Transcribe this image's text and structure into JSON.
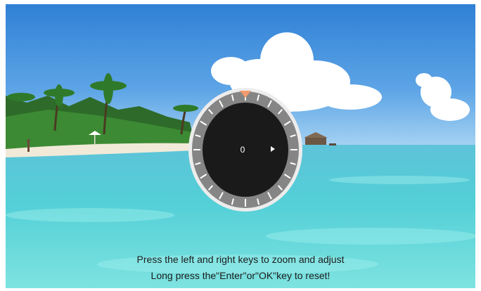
{
  "zoom_dial": {
    "value": "0",
    "arrow_icon": "right-arrow-icon",
    "pointer_icon": "triangle-pointer-icon"
  },
  "instructions": {
    "line1": "Press the left and right keys to zoom and adjust",
    "line2": "Long press the\"Enter\"or\"OK\"key to reset!"
  },
  "colors": {
    "pointer": "#f39b6d",
    "dial_face": "#1a1a1a",
    "dial_ring": "#858585"
  }
}
